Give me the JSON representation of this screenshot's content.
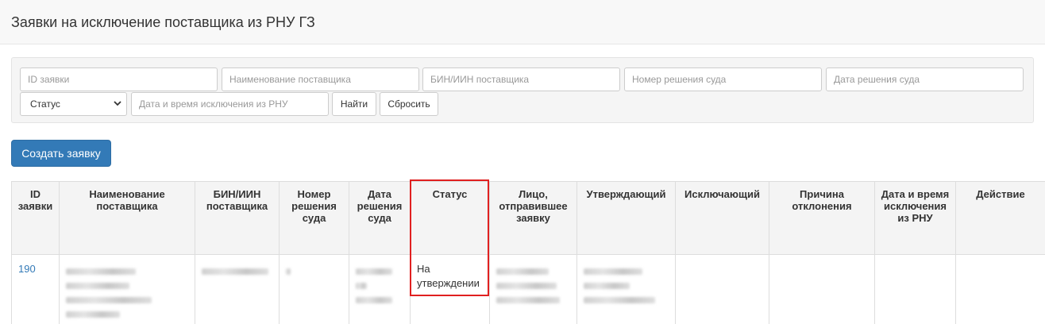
{
  "page": {
    "title": "Заявки на исключение поставщика из РНУ ГЗ"
  },
  "filters": {
    "id_placeholder": "ID заявки",
    "supplier_name_placeholder": "Наименование поставщика",
    "bin_placeholder": "БИН/ИИН поставщика",
    "court_number_placeholder": "Номер решения суда",
    "court_date_placeholder": "Дата решения суда",
    "status_value": "Статус",
    "exclusion_datetime_placeholder": "Дата и время исключения из РНУ",
    "find_label": "Найти",
    "reset_label": "Сбросить"
  },
  "actions": {
    "create_label": "Создать заявку"
  },
  "table": {
    "columns": [
      "ID заявки",
      "Наименование поставщика",
      "БИН/ИИН поставщика",
      "Номер решения суда",
      "Дата решения суда",
      "Статус",
      "Лицо, отправившее заявку",
      "Утверждающий",
      "Исключающий",
      "Причина отклонения",
      "Дата и время исключения из РНУ",
      "Действие"
    ],
    "rows": [
      {
        "id": "190",
        "status": "На утверждении"
      }
    ]
  },
  "highlight_color": "#e02020"
}
